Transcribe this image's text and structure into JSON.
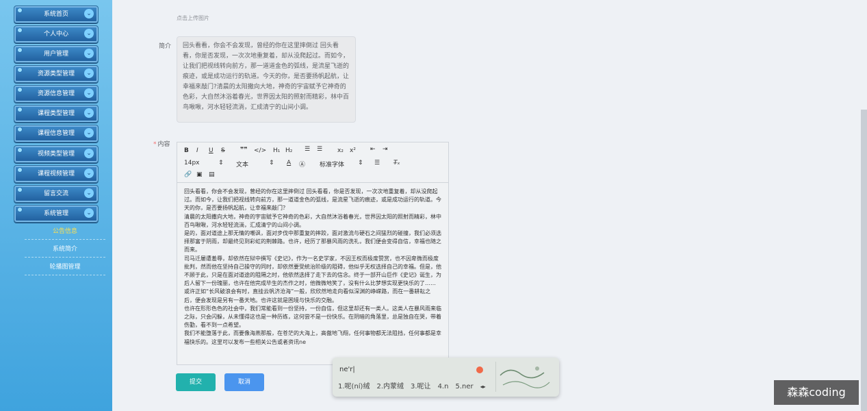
{
  "sidebar": {
    "menu": [
      {
        "label": "系统首页"
      },
      {
        "label": "个人中心"
      },
      {
        "label": "用户管理"
      },
      {
        "label": "资源类型管理"
      },
      {
        "label": "资源信息管理"
      },
      {
        "label": "课程类型管理"
      },
      {
        "label": "课程信息管理"
      },
      {
        "label": "视频类型管理"
      },
      {
        "label": "课程视频管理"
      },
      {
        "label": "留言交流"
      },
      {
        "label": "系统管理"
      }
    ],
    "submenu": [
      {
        "label": "公告信息"
      },
      {
        "label": "系统简介"
      },
      {
        "label": "轮播图管理"
      }
    ]
  },
  "form": {
    "upload_hint": "点击上传图片",
    "intro_label": "简介",
    "intro_text": "回头看看，你会不会发现，曾经的你在这里摔倒过 回头看看，你是否发现，一次次地重复着，却从没爬起过。而如今，让我们把视线转向前方，那一道道金色的弧线，是流星飞逝的痕迹，或是成功运行的轨道。今天的你，是否要扬帆起航，让幸福来敲门?清晨的太阳撒向大地，神奇的宇宙赋予它神奇的色彩，大自然沐浴着春光，世界因太阳的照射而精彩，林中百鸟啾啾，河水轻轻流淌，汇成清宁的山间小调。",
    "content_required": "*",
    "content_label": "内容",
    "submit_label": "提交",
    "cancel_label": "取消"
  },
  "editor": {
    "font_size": "14px",
    "block_type": "文本",
    "font_family": "标准字体",
    "paragraphs": [
      "回头看看，你会不会发现，曾经的你在这里摔倒过 回头看看，你是否发现，一次次地重复着，却从没爬起过。而如今，让我们把视线转向前方，那一道道金色的弧线，是流星飞逝的痕迹，或是成功运行的轨道。今天的你，是否要扬帆起航，让幸福来敲门？",
      "清晨的太阳撒向大地，神奇的宇宙赋予它神奇的色彩，大自然沐浴着春光，世界因太阳的照射而精彩，林中百鸟啾啾，河水轻轻流淌，汇成清宁的山间小调。",
      "是的，面对道途上那无情的嘲讽，面对步伐中那重复的摔跤，面对激流与硬石之间猛烈的碰撞，我们必须选择那富于阴雨，却最终见到彩虹的荆棘路。也许，经历了那暴风雨的洗礼，我们便会变得自信，幸福也随之而来。",
      "司马迁屡遭羞辱，却依然在狱中撰写《史记》，作为一名史学家，不因王权而极度赞赏，也不因卑微而极度批判，然而他在坚持自己操守的同时，却依然要受統治阶级的阻碍，他似乎无权选择自己的幸福。但是，他不顾于此，只是在面对道途的阻隔之时，他依然选择了走下去的信念。终于一部开山巨作《史记》诞生，为后人留下一份瑰丽，也许在他完成毕生的杰作之时，他微微地笑了，没有什么比梦想实现更快乐的了……",
      "或许正如“长风破浪会有时，直挂云帆济沧海”一般，欣欣然地走向看似深渊的峥嵘路，而在一番耕耘之后，便会发现是另有一番天地。也许这就是困境与快乐的交融。",
      "也许在形形色色的社会中，我们常能看到一份坚持，一份自信，但这里却还有一类人。这类人在暴风雨来临之际，只会闪躲，从未懂得这也是一种历练，这何尝不是一份快乐。在阴暗的角落里，总是独自在哭，带着伤勤，看不到一点希望。",
      "我们不能堕落于此，而要像海燕那般，在苍茫的大海上，高傲地飞翔，任何事物都无法阻挡，任何事都是幸福快乐的。这里可以发布一些相关公告或者资讯ne"
    ]
  },
  "ime": {
    "input": "ne'r|",
    "candidates": [
      "1.呢(ní)绒",
      "2.内蒙绒",
      "3.呢让",
      "4.n",
      "5.ner"
    ]
  },
  "watermark": "森森coding",
  "colors": {
    "sidebar_top": "#79c6ee",
    "sidebar_bottom": "#3fa3de",
    "nav_button": "#2a6eaf",
    "submit": "#22b1ad",
    "cancel": "#4b95ee",
    "active_sub": "#ffe14f"
  }
}
